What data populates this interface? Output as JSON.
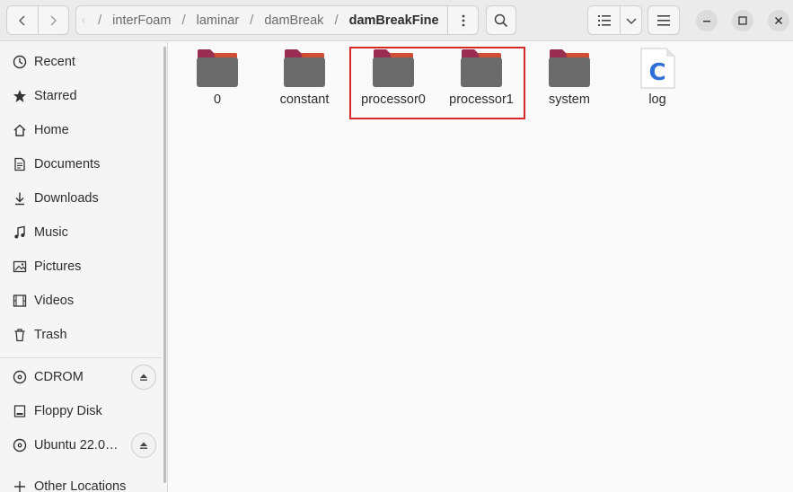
{
  "header": {
    "back_icon": "chevron-left-icon",
    "forward_icon": "chevron-right-icon",
    "path_truncation_icon": "ellipsis-left-icon",
    "breadcrumbs": [
      "interFoam",
      "laminar",
      "damBreak",
      "damBreakFine"
    ],
    "path_menu_icon": "vertical-dots-icon",
    "search_icon": "search-icon",
    "view_list_icon": "list-view-icon",
    "view_options_icon": "chevron-down-icon",
    "main_menu_icon": "hamburger-menu-icon",
    "window_controls": [
      "minimize-icon",
      "maximize-icon",
      "close-icon"
    ]
  },
  "sidebar": {
    "items": [
      {
        "label": "Recent",
        "icon": "clock-icon"
      },
      {
        "label": "Starred",
        "icon": "star-icon"
      },
      {
        "label": "Home",
        "icon": "home-icon"
      },
      {
        "label": "Documents",
        "icon": "document-icon"
      },
      {
        "label": "Downloads",
        "icon": "download-icon"
      },
      {
        "label": "Music",
        "icon": "music-note-icon"
      },
      {
        "label": "Pictures",
        "icon": "picture-icon"
      },
      {
        "label": "Videos",
        "icon": "video-icon"
      },
      {
        "label": "Trash",
        "icon": "trash-icon"
      }
    ],
    "devices": [
      {
        "label": "CDROM",
        "icon": "disc-icon",
        "eject": true
      },
      {
        "label": "Floppy Disk",
        "icon": "drive-icon",
        "eject": false
      },
      {
        "label": "Ubuntu 22.0…",
        "icon": "disc-icon",
        "eject": true
      }
    ],
    "other": {
      "label": "Other Locations",
      "icon": "plus-icon"
    }
  },
  "content": {
    "files": [
      {
        "name": "0",
        "type": "folder"
      },
      {
        "name": "constant",
        "type": "folder"
      },
      {
        "name": "processor0",
        "type": "folder"
      },
      {
        "name": "processor1",
        "type": "folder"
      },
      {
        "name": "system",
        "type": "folder"
      },
      {
        "name": "log",
        "type": "c-source-file",
        "glyph": "C"
      }
    ],
    "highlighted_files": [
      "processor0",
      "processor1"
    ],
    "highlight_color": "#d62828"
  },
  "colors": {
    "folder_body": "#6b6b6b",
    "folder_tab": "#9b2d52",
    "folder_tab_accent": "#e05a2b",
    "c_file_glyph": "#2f6fd6"
  }
}
